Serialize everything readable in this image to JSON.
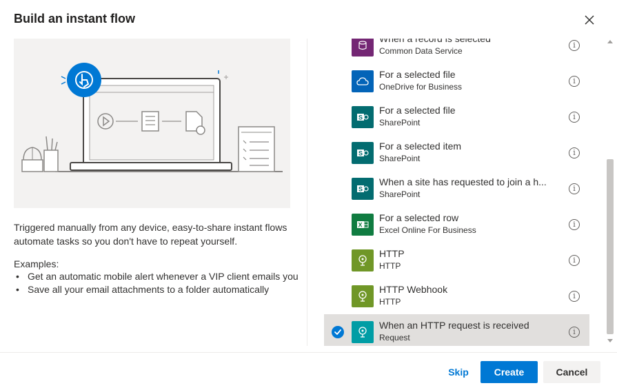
{
  "dialog": {
    "title": "Build an instant flow",
    "description": "Triggered manually from any device, easy-to-share instant flows automate tasks so you don't have to repeat yourself.",
    "examples_label": "Examples:",
    "examples": [
      "Get an automatic mobile alert whenever a VIP client emails you",
      "Save all your email attachments to a folder automatically"
    ]
  },
  "triggers": [
    {
      "title": "When a record is selected",
      "subtitle": "Common Data Service",
      "icon": "cds-icon",
      "color": "#742774",
      "selected": false
    },
    {
      "title": "For a selected file",
      "subtitle": "OneDrive for Business",
      "icon": "onedrive-icon",
      "color": "#0364b8",
      "selected": false
    },
    {
      "title": "For a selected file",
      "subtitle": "SharePoint",
      "icon": "sharepoint-icon",
      "color": "#036c70",
      "selected": false
    },
    {
      "title": "For a selected item",
      "subtitle": "SharePoint",
      "icon": "sharepoint-icon",
      "color": "#036c70",
      "selected": false
    },
    {
      "title": "When a site has requested to join a h...",
      "subtitle": "SharePoint",
      "icon": "sharepoint-icon",
      "color": "#036c70",
      "selected": false
    },
    {
      "title": "For a selected row",
      "subtitle": "Excel Online For Business",
      "icon": "excel-icon",
      "color": "#107c41",
      "selected": false
    },
    {
      "title": "HTTP",
      "subtitle": "HTTP",
      "icon": "http-icon",
      "color": "#709727",
      "selected": false
    },
    {
      "title": "HTTP Webhook",
      "subtitle": "HTTP",
      "icon": "http-icon",
      "color": "#709727",
      "selected": false
    },
    {
      "title": "When an HTTP request is received",
      "subtitle": "Request",
      "icon": "request-icon",
      "color": "#009da5",
      "selected": true
    }
  ],
  "footer": {
    "skip_label": "Skip",
    "create_label": "Create",
    "cancel_label": "Cancel"
  },
  "colors": {
    "accent": "#0078d4",
    "selected_row": "#e1dfdd"
  }
}
